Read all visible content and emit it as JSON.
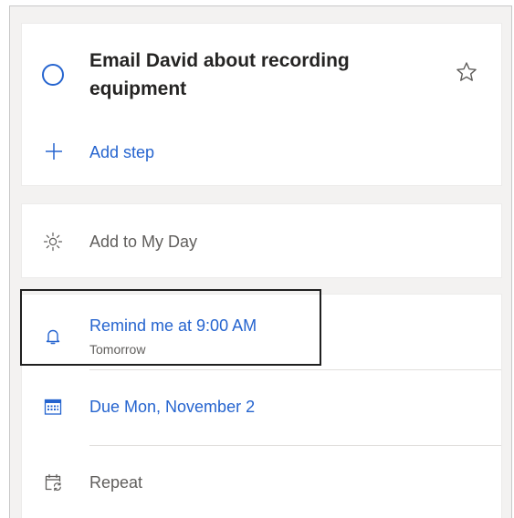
{
  "task": {
    "title": "Email David about recording equipment",
    "add_step_label": "Add step"
  },
  "my_day": {
    "label": "Add to My Day"
  },
  "reminder": {
    "label": "Remind me at 9:00 AM",
    "sublabel": "Tomorrow"
  },
  "due": {
    "label": "Due Mon, November 2"
  },
  "repeat": {
    "label": "Repeat"
  },
  "icons": {
    "complete": "circle-icon",
    "importance": "star-icon",
    "add_step": "plus-icon",
    "my_day": "sun-icon",
    "reminder": "bell-icon",
    "due": "calendar-icon",
    "repeat": "repeat-icon"
  },
  "colors": {
    "accent": "#2564cf",
    "text_primary": "#252423",
    "text_secondary": "#605e5c",
    "panel_background": "#f3f2f1",
    "card_background": "#ffffff",
    "highlight_border": "#1f1f1f"
  }
}
